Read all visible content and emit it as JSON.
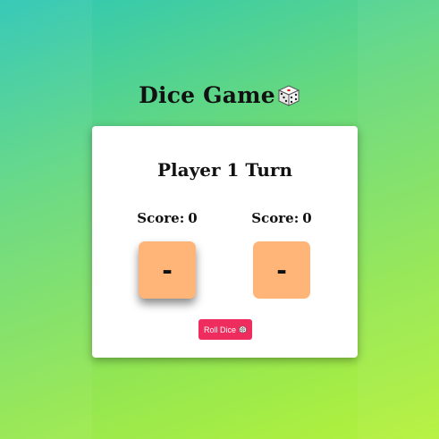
{
  "header": {
    "title": "Dice Game",
    "title_icon": "dice-icon"
  },
  "game": {
    "turn_text": "Player 1 Turn",
    "players": [
      {
        "score_label": "Score:",
        "score_value": "0",
        "dice_value": "-"
      },
      {
        "score_label": "Score:",
        "score_value": "0",
        "dice_value": "-"
      }
    ],
    "roll_button_label": "Roll Dice",
    "roll_button_icon": "dice-icon"
  },
  "colors": {
    "background_gradient": [
      "#2ec7b5",
      "#b5f23a"
    ],
    "card": "#ffffff",
    "dice_box": "#ffb478",
    "button": "#ee2c5e"
  }
}
